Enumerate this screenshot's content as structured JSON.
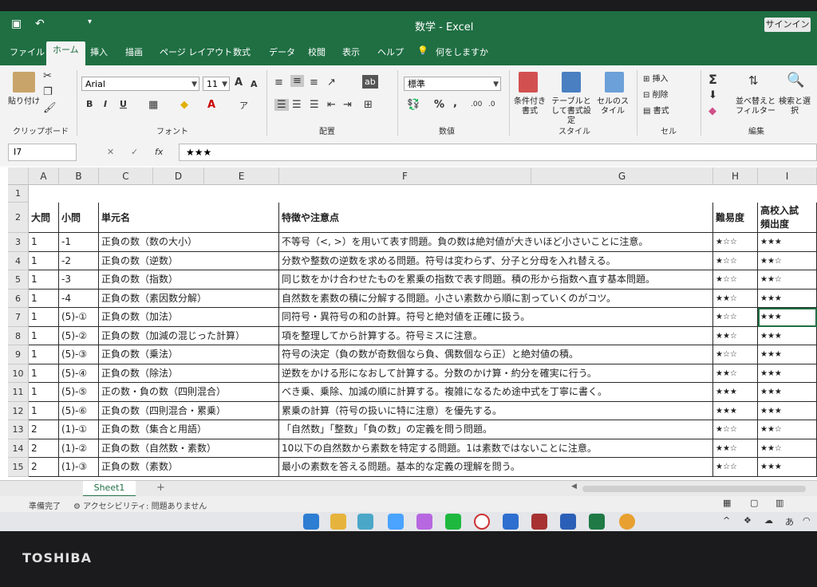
{
  "window": {
    "title": "数学 - Excel",
    "signin": "サインイン",
    "undo": "↶",
    "save": "💾"
  },
  "menu": [
    "ファイル",
    "ホーム",
    "挿入",
    "描画",
    "ページ レイアウト",
    "数式",
    "データ",
    "校閲",
    "表示",
    "ヘルプ",
    "何をしますか"
  ],
  "ribbon": {
    "clipboard": {
      "paste": "貼り付け",
      "label": "クリップボード"
    },
    "font": {
      "name": "Arial",
      "size": "11",
      "label": "フォント",
      "bold": "B",
      "italic": "I",
      "underline": "U",
      "grow": "A",
      "shrink": "A"
    },
    "alignment": {
      "label": "配置"
    },
    "number": {
      "format": "標準",
      "percent": "%",
      "comma": ",",
      "label": "数値"
    },
    "styles": {
      "conditional": "条件付き書式",
      "table": "テーブルとして書式設定",
      "cell": "セルのスタイル",
      "label": "スタイル"
    },
    "cells": {
      "insert": "挿入",
      "delete": "削除",
      "format": "書式",
      "label": "セル"
    },
    "editing": {
      "sort": "並べ替えとフィルター",
      "find": "検索と選択",
      "sum": "Σ",
      "label": "編集"
    }
  },
  "formula": {
    "namebox": "I7",
    "cancel": "✕",
    "enter": "✓",
    "fx": "fx",
    "value": "★★★"
  },
  "columns": [
    "A",
    "B",
    "C",
    "D",
    "E",
    "F",
    "G",
    "H",
    "I"
  ],
  "headers": {
    "a": "大問",
    "b": "小問",
    "c": "単元名",
    "f": "特徴や注意点",
    "h": "難易度",
    "i1": "高校入試",
    "i2": "頻出度"
  },
  "rows": [
    {
      "n": "3",
      "a": "1",
      "b": "-1",
      "c": "正負の数（数の大小）",
      "f": "不等号（<, >）を用いて表す問題。負の数は絶対値が大きいほど小さいことに注意。",
      "h": "★☆☆",
      "i": "★★★"
    },
    {
      "n": "4",
      "a": "1",
      "b": "-2",
      "c": "正負の数（逆数）",
      "f": "分数や整数の逆数を求める問題。符号は変わらず、分子と分母を入れ替える。",
      "h": "★☆☆",
      "i": "★★☆"
    },
    {
      "n": "5",
      "a": "1",
      "b": "-3",
      "c": "正負の数（指数）",
      "f": "同じ数をかけ合わせたものを累乗の指数で表す問題。積の形から指数へ直す基本問題。",
      "h": "★☆☆",
      "i": "★★☆"
    },
    {
      "n": "6",
      "a": "1",
      "b": "-4",
      "c": "正負の数（素因数分解）",
      "f": "自然数を素数の積に分解する問題。小さい素数から順に割っていくのがコツ。",
      "h": "★★☆",
      "i": "★★★"
    },
    {
      "n": "7",
      "a": "1",
      "b": "(5)-①",
      "c": "正負の数（加法）",
      "f": "同符号・異符号の和の計算。符号と絶対値を正確に扱う。",
      "h": "★☆☆",
      "i": "★★★"
    },
    {
      "n": "8",
      "a": "1",
      "b": "(5)-②",
      "c": "正負の数（加減の混じった計算）",
      "f": "項を整理してから計算する。符号ミスに注意。",
      "h": "★★☆",
      "i": "★★★"
    },
    {
      "n": "9",
      "a": "1",
      "b": "(5)-③",
      "c": "正負の数（乗法）",
      "f": "符号の決定（負の数が奇数個なら負、偶数個なら正）と絶対値の積。",
      "h": "★☆☆",
      "i": "★★★"
    },
    {
      "n": "10",
      "a": "1",
      "b": "(5)-④",
      "c": "正負の数（除法）",
      "f": "逆数をかける形になおして計算する。分数のかけ算・約分を確実に行う。",
      "h": "★★☆",
      "i": "★★★"
    },
    {
      "n": "11",
      "a": "1",
      "b": "(5)-⑤",
      "c": "正の数・負の数（四則混合）",
      "f": "べき乗、乗除、加減の順に計算する。複雑になるため途中式を丁寧に書く。",
      "h": "★★★",
      "i": "★★★"
    },
    {
      "n": "12",
      "a": "1",
      "b": "(5)-⑥",
      "c": "正負の数（四則混合・累乗）",
      "f": "累乗の計算（符号の扱いに特に注意）を優先する。",
      "h": "★★★",
      "i": "★★★"
    },
    {
      "n": "13",
      "a": "2",
      "b": "(1)-①",
      "c": "正負の数（集合と用語）",
      "f": "「自然数」「整数」「負の数」の定義を問う問題。",
      "h": "★☆☆",
      "i": "★★☆"
    },
    {
      "n": "14",
      "a": "2",
      "b": "(1)-②",
      "c": "正負の数（自然数・素数）",
      "f": "10以下の自然数から素数を特定する問題。1は素数ではないことに注意。",
      "h": "★★☆",
      "i": "★★☆"
    },
    {
      "n": "15",
      "a": "2",
      "b": "(1)-③",
      "c": "正負の数（素数）",
      "f": "最小の素数を答える問題。基本的な定義の理解を問う。",
      "h": "★☆☆",
      "i": "★★★"
    }
  ],
  "sheet": {
    "tab": "Sheet1",
    "add": "+"
  },
  "status": {
    "ready": "準備完了",
    "accessibility": "アクセシビリティ: 問題ありません"
  },
  "tray": {
    "ime": "あ"
  },
  "brand": "TOSHIBA"
}
